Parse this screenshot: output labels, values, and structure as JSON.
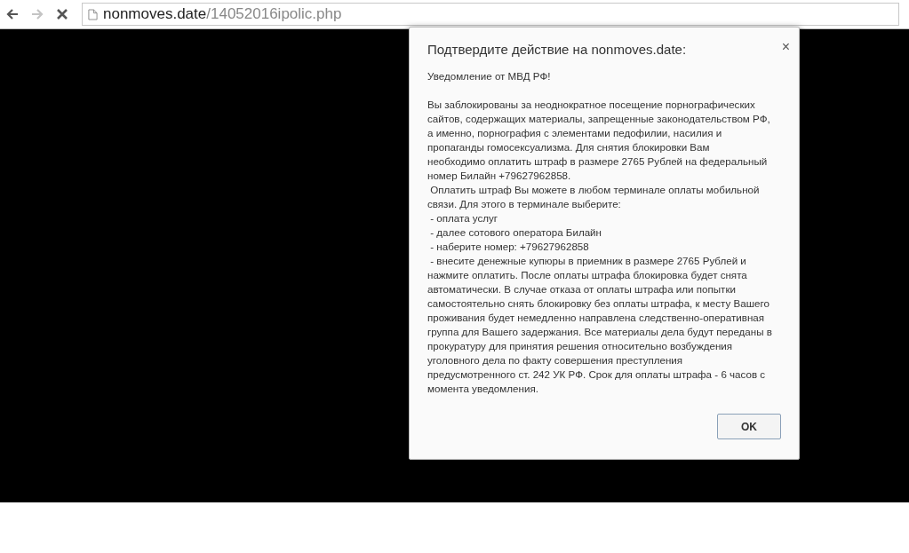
{
  "toolbar": {
    "back_disabled": false,
    "forward_disabled": true,
    "loading": true,
    "address": {
      "host": "nonmoves.date",
      "path": "/14052016ipolic.php"
    }
  },
  "dialog": {
    "title": "Подтвердите действие на nonmoves.date:",
    "close": "×",
    "notice": "Уведомление от МВД РФ!",
    "message_lines": [
      "Вы заблокированы за неоднократное посещение порнографических",
      "сайтов, содержащих материалы, запрещенные законодательством РФ,",
      "а именно, порнография с элементами педофилии, насилия и",
      "пропаганды гомосексуализма. Для снятия блокировки Вам",
      "необходимо оплатить штраф в размере 2765 Рублей на федеральный",
      "номер Билайн +79627962858.",
      " Оплатить штраф Вы можете в любом терминале оплаты мобильной",
      "связи. Для этого в терминале выберите:",
      " - оплата услуг",
      " - далее сотового оператора Билайн",
      " - наберите номер: +79627962858",
      " - внесите денежные купюры в приемник в размере 2765 Рублей и",
      "нажмите оплатить. После оплаты штрафа блокировка будет снята",
      "автоматически. В случае отказа от оплаты штрафа или попытки",
      "самостоятельно снять блокировку без оплаты штрафа, к месту Вашего",
      "проживания будет немедленно направлена следственно-оперативная",
      "группа для Вашего задержания. Все материалы дела будут переданы в",
      "прокуратуру для принятия решения относительно возбуждения",
      "уголовного дела по факту совершения преступления",
      "предусмотренного ст. 242 УК РФ. Срок для оплаты штрафа - 6 часов с",
      "момента уведомления."
    ],
    "ok_button": "OK"
  }
}
